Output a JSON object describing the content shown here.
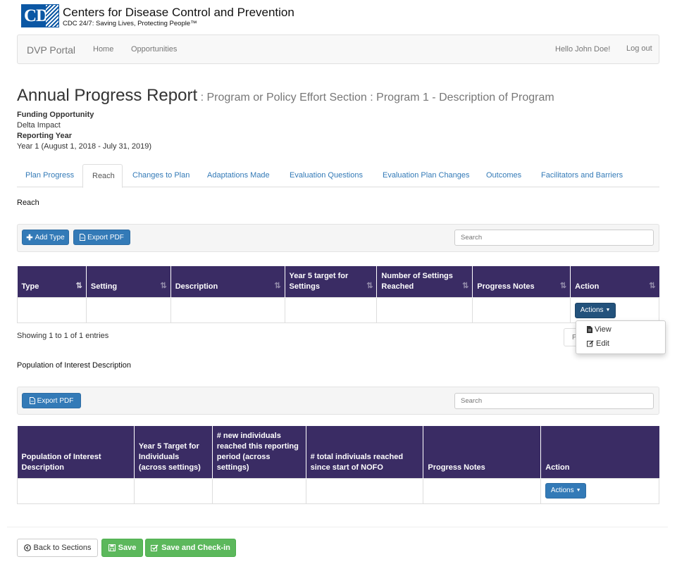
{
  "header": {
    "logo_text": "CDC",
    "org_name": "Centers for Disease Control and Prevention",
    "tagline": "CDC 24/7: Saving Lives, Protecting People™"
  },
  "navbar": {
    "brand": "DVP Portal",
    "links": [
      "Home",
      "Opportunities"
    ],
    "greeting": "Hello John Doe!",
    "logout": "Log out"
  },
  "page": {
    "title": "Annual Progress Report",
    "subtitle": " : Program or Policy Effort Section : Program 1 - Description of Program",
    "funding_label": "Funding Opportunity",
    "funding_value": "Delta Impact",
    "year_label": "Reporting Year",
    "year_value": "Year 1 (August 1, 2018 - July 31, 2019)"
  },
  "tabs": [
    {
      "label": "Plan Progress",
      "active": false
    },
    {
      "label": "Reach",
      "active": true
    },
    {
      "label": "Changes to Plan",
      "active": false
    },
    {
      "label": "Adaptations Made",
      "active": false
    },
    {
      "label": "Evaluation Questions",
      "active": false
    },
    {
      "label": "Evaluation Plan Changes",
      "active": false
    },
    {
      "label": "Outcomes",
      "active": false
    },
    {
      "label": "Facilitators and Barriers",
      "active": false
    }
  ],
  "reach": {
    "section_title": "Reach",
    "add_type_label": "Add Type",
    "export_pdf_label": "Export PDF",
    "search_placeholder": "Search",
    "columns": [
      "Type",
      "Setting",
      "Description",
      "Year 5 target for Settings",
      "Number of Settings Reached",
      "Progress Notes",
      "Action"
    ],
    "row_action_label": "Actions",
    "showing": "Showing 1 to 1 of 1 entries",
    "pager_stub": "P",
    "dropdown": [
      "View",
      "Edit"
    ]
  },
  "population": {
    "section_title": "Population of Interest Description",
    "export_pdf_label": "Export PDF",
    "search_placeholder": "Search",
    "columns": [
      "Population of Interest Description",
      "Year 5 Target for Individuals (across settings)",
      "# new individuals reached this reporting period (across settings)",
      "# total indiviuals reached since start of NOFO",
      "Progress Notes",
      "Action"
    ],
    "row_action_label": "Actions"
  },
  "footer": {
    "back_label": "Back to Sections",
    "save_label": "Save",
    "save_checkin_label": "Save and Check-in"
  },
  "colors": {
    "table_header": "#3a2c64",
    "primary": "#337ab7",
    "success": "#5cb85c",
    "logo_blue": "#0b57a4"
  }
}
